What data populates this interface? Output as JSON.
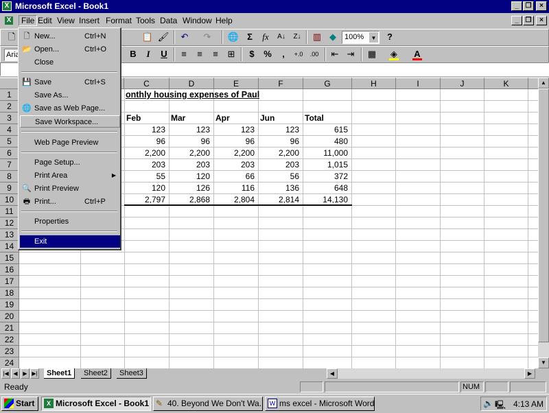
{
  "window": {
    "title": "Microsoft Excel - Book1"
  },
  "menubar": {
    "items": [
      "File",
      "Edit",
      "View",
      "Insert",
      "Format",
      "Tools",
      "Data",
      "Window",
      "Help"
    ]
  },
  "toolbar": {
    "zoom": "100%",
    "font_partial": "Aria"
  },
  "columns": [
    "C",
    "D",
    "E",
    "F",
    "G",
    "H",
    "I",
    "J",
    "K"
  ],
  "rows": [
    "1",
    "2",
    "3",
    "4",
    "5",
    "6",
    "7",
    "8",
    "9",
    "10",
    "11",
    "12",
    "13",
    "14",
    "15",
    "16",
    "17",
    "18",
    "19",
    "20",
    "21",
    "22",
    "23",
    "24"
  ],
  "sheet": {
    "title": "onthly housing expenses of Paul",
    "headers": [
      "Feb",
      "Mar",
      "Apr",
      "Jun",
      "Total"
    ],
    "data": [
      [
        "123",
        "123",
        "123",
        "123",
        "615"
      ],
      [
        "96",
        "96",
        "96",
        "96",
        "480"
      ],
      [
        "2,200",
        "2,200",
        "2,200",
        "2,200",
        "11,000"
      ],
      [
        "203",
        "203",
        "203",
        "203",
        "1,015"
      ],
      [
        "55",
        "120",
        "66",
        "56",
        "372"
      ],
      [
        "120",
        "126",
        "116",
        "136",
        "648"
      ],
      [
        "2,797",
        "2,868",
        "2,804",
        "2,814",
        "14,130"
      ]
    ]
  },
  "file_menu": {
    "items": [
      {
        "label": "New...",
        "shortcut": "Ctrl+N",
        "icon": "new-doc-icon"
      },
      {
        "label": "Open...",
        "shortcut": "Ctrl+O",
        "icon": "open-folder-icon"
      },
      {
        "label": "Close",
        "shortcut": ""
      },
      {
        "label": "Save",
        "shortcut": "Ctrl+S",
        "icon": "save-disk-icon"
      },
      {
        "label": "Save As...",
        "shortcut": ""
      },
      {
        "label": "Save as Web Page...",
        "shortcut": "",
        "icon": "web-page-icon"
      },
      {
        "label": "Save Workspace...",
        "shortcut": ""
      },
      {
        "label": "Web Page Preview",
        "shortcut": ""
      },
      {
        "label": "Page Setup...",
        "shortcut": ""
      },
      {
        "label": "Print Area",
        "shortcut": ""
      },
      {
        "label": "Print Preview",
        "shortcut": "",
        "icon": "print-preview-icon"
      },
      {
        "label": "Print...",
        "shortcut": "Ctrl+P",
        "icon": "printer-icon"
      },
      {
        "label": "Properties",
        "shortcut": ""
      },
      {
        "label": "Exit",
        "shortcut": ""
      }
    ]
  },
  "tabs": [
    "Sheet1",
    "Sheet2",
    "Sheet3"
  ],
  "status": {
    "text": "Ready",
    "num": "NUM"
  },
  "taskbar": {
    "start": "Start",
    "tasks": [
      "Microsoft Excel - Book1",
      "40. Beyond We Don't Wa...",
      "ms excel - Microsoft Word"
    ],
    "clock": "4:13 AM"
  }
}
